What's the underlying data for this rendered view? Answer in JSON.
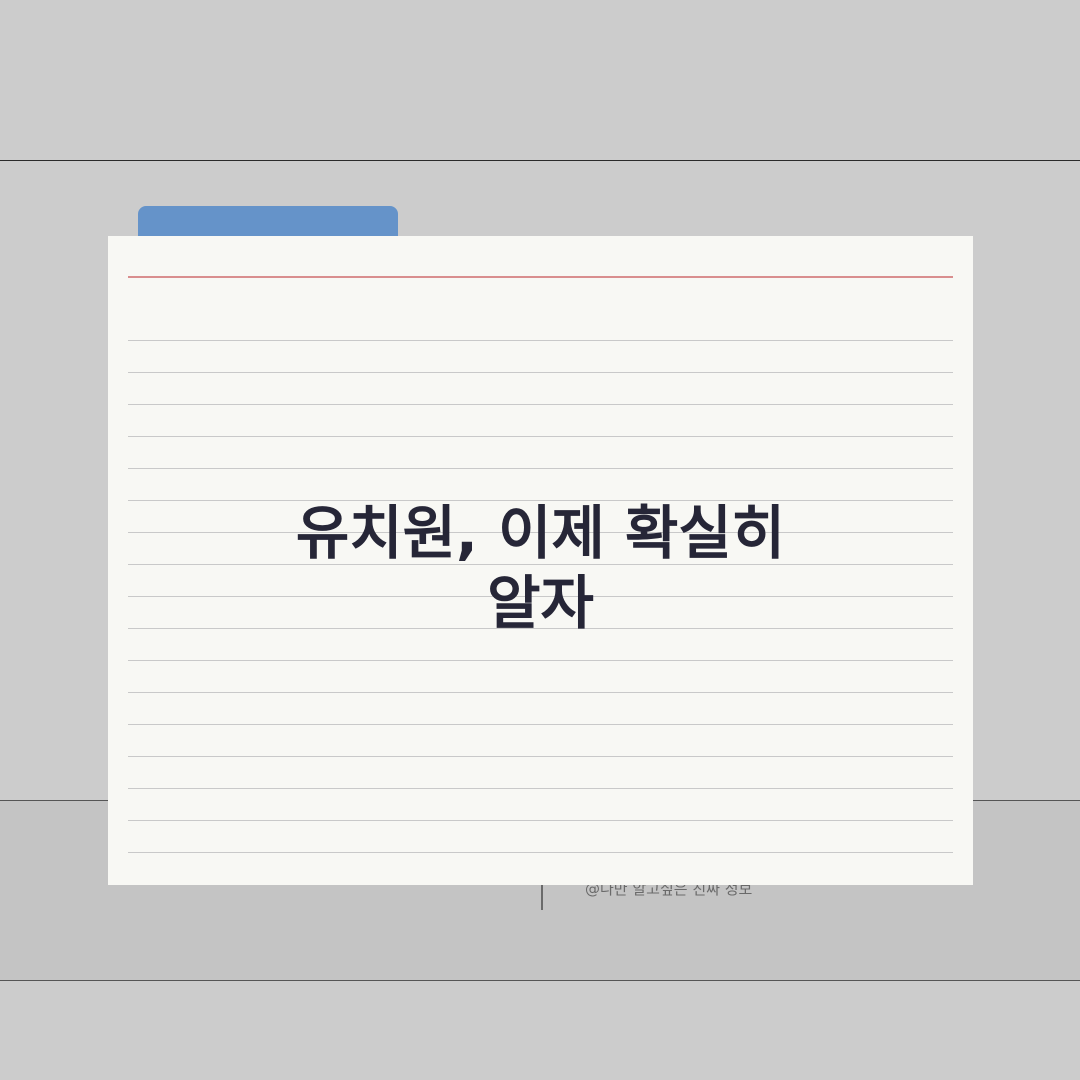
{
  "card": {
    "title_line1": "유치원, 이제 확실히",
    "title_line2": "알자"
  },
  "footer": {
    "credit": "@나만 알고싶은 진짜 정보"
  },
  "colors": {
    "background": "#cccccc",
    "tab": "#6593c9",
    "card": "#f8f8f4",
    "margin_line": "#d98e8e",
    "title_text": "#262637"
  }
}
